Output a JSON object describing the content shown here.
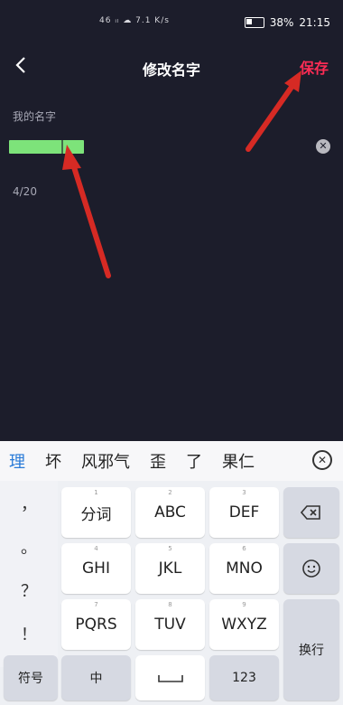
{
  "status_bar": {
    "left_icons": "46 ᵢₗ ☁ 7.1 K/s",
    "battery_percent": "38%",
    "time": "21:15"
  },
  "header": {
    "title": "修改名字",
    "save_label": "保存"
  },
  "form": {
    "label": "我的名字",
    "counter": "4/20"
  },
  "keyboard": {
    "candidates": [
      "理",
      "坏",
      "风邪气",
      "歪",
      "了",
      "果仁"
    ],
    "punctuation": [
      "，",
      "。",
      "？",
      "！"
    ],
    "rows": [
      [
        {
          "hint": "1",
          "label": "分词"
        },
        {
          "hint": "2",
          "label": "ABC"
        },
        {
          "hint": "3",
          "label": "DEF"
        }
      ],
      [
        {
          "hint": "4",
          "label": "GHI"
        },
        {
          "hint": "5",
          "label": "JKL"
        },
        {
          "hint": "6",
          "label": "MNO"
        }
      ],
      [
        {
          "hint": "7",
          "label": "PQRS"
        },
        {
          "hint": "8",
          "label": "TUV"
        },
        {
          "hint": "9",
          "label": "WXYZ"
        }
      ]
    ],
    "symbol_label": "符号",
    "chinese_label": "中",
    "num_label": "123",
    "enter_label": "换行"
  },
  "colors": {
    "app_background": "#1c1d2b",
    "save_accent": "#ff2c55",
    "name_highlight": "#7de37a",
    "annotation_arrow": "#d62a24"
  }
}
